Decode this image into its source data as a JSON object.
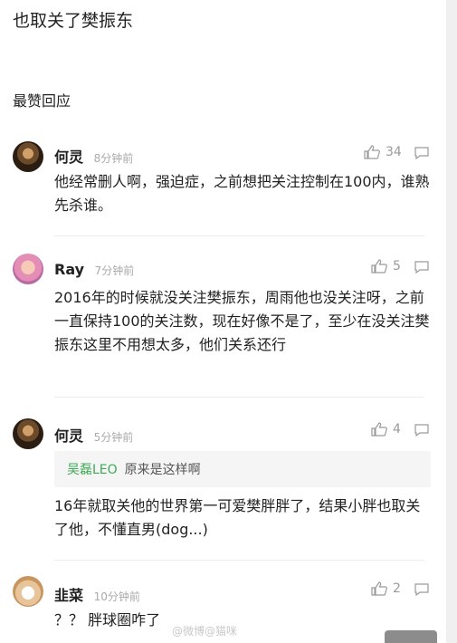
{
  "post": {
    "text": "也取关了樊振东"
  },
  "section": {
    "title": "最赞回应"
  },
  "comments": [
    {
      "name": "何灵",
      "time": "8分钟前",
      "likes": "34",
      "text": "他经常删人啊，强迫症，之前想把关注控制在100内，谁熟先杀谁。"
    },
    {
      "name": "Ray",
      "time": "7分钟前",
      "likes": "5",
      "text": "2016年的时候就没关注樊振东，周雨他也没关注呀，之前一直保持100的关注数，现在好像不是了，至少在没关注樊振东这里不用想太多，他们关系还行"
    },
    {
      "name": "何灵",
      "time": "5分钟前",
      "likes": "4",
      "quote_user": "吴磊LEO",
      "quote_text": "原来是这样啊",
      "text": "16年就取关他的世界第一可爱樊胖胖了，结果小胖也取关了他，不懂直男(dog...)"
    },
    {
      "name": "韭菜",
      "time": "10分钟前",
      "likes": "2",
      "text": "？？ 胖球圈咋了"
    }
  ],
  "watermark": "@微博@猫咪",
  "icons": [
    "thumbs-up-icon",
    "reply-icon"
  ]
}
